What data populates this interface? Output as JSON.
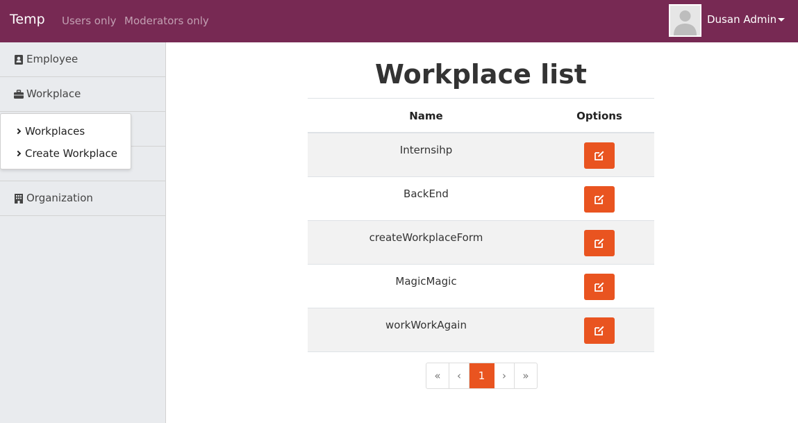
{
  "navbar": {
    "brand": "Temp",
    "links": [
      "Users only",
      "Moderators only"
    ],
    "user_name": "Dusan Admin",
    "color": "#772953"
  },
  "sidebar": {
    "items": [
      {
        "label": "Employee",
        "icon": "address-card-icon"
      },
      {
        "label": "Workplace",
        "icon": "briefcase-icon"
      },
      {
        "label": "Organization",
        "icon": "building-icon"
      }
    ],
    "dropdown": [
      "Workplaces",
      "Create Workplace"
    ]
  },
  "main": {
    "title": "Workplace list",
    "columns": [
      "Name",
      "Options"
    ],
    "rows": [
      "Internsihp",
      "BackEnd",
      "createWorkplaceForm",
      "MagicMagic",
      "workWorkAgain"
    ],
    "edit_icon": "edit-icon",
    "accent": "#e95420"
  },
  "pagination": {
    "first": "«",
    "prev": "‹",
    "current": "1",
    "next": "›",
    "last": "»"
  }
}
